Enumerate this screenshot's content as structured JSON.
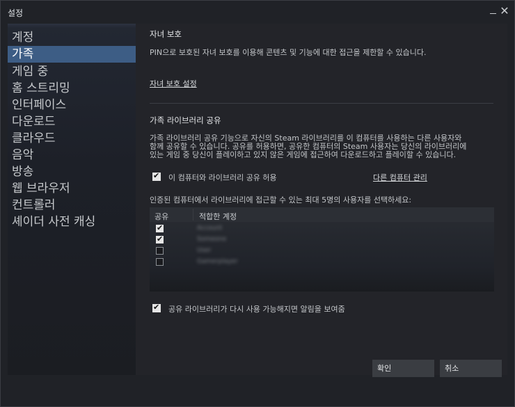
{
  "window": {
    "title": "설정"
  },
  "sidebar": {
    "items": [
      {
        "label": "계정"
      },
      {
        "label": "가족"
      },
      {
        "label": "게임 중"
      },
      {
        "label": "홈 스트리밍"
      },
      {
        "label": "인터페이스"
      },
      {
        "label": "다운로드"
      },
      {
        "label": "클라우드"
      },
      {
        "label": "음악"
      },
      {
        "label": "방송"
      },
      {
        "label": "웹 브라우저"
      },
      {
        "label": "컨트롤러"
      },
      {
        "label": "셰이더 사전 캐싱"
      }
    ],
    "active_index": 1
  },
  "parental": {
    "heading": "자녀 보호",
    "description": "PIN으로 보호된 자녀 보호를 이용해 콘텐츠 및 기능에 대한 접근을 제한할 수 있습니다.",
    "settings_link": "자녀 보호 설정"
  },
  "family": {
    "heading": "가족 라이브러리 공유",
    "desc_line1": "가족 라이브러리 공유 기능으로 자신의 Steam 라이브러리를 이 컴퓨터를 사용하는 다른 사용자와",
    "desc_line2": "함께 공유할 수 있습니다. 공유를 허용하면, 공유한 컴퓨터의 Steam 사용자는 당신의 라이브러리에",
    "desc_line3": "있는 게임 중 당신이 플레이하고 있지 않은 게임에 접근하여 다운로드하고 플레이할 수 있습니다.",
    "allow_label": "이 컴퓨터와 라이브러리 공유 허용",
    "allow_checked": true,
    "manage_link": "다른 컴퓨터 관리",
    "select_instruction": "인증된 컴퓨터에서 라이브러리에 접근할 수 있는 최대 5명의 사용자를 선택하세요:",
    "table": {
      "col_share": "공유",
      "col_account": "적합한 계정",
      "rows": [
        {
          "checked": true,
          "name": "Account"
        },
        {
          "checked": true,
          "name": "Someone"
        },
        {
          "checked": false,
          "name": "User"
        },
        {
          "checked": false,
          "name": "Gamerplayer"
        }
      ]
    },
    "notify_label": "공유 라이브러리가 다시 사용 가능해지면 알림을 보여줌",
    "notify_checked": true
  },
  "footer": {
    "ok_label": "확인",
    "cancel_label": "취소"
  }
}
